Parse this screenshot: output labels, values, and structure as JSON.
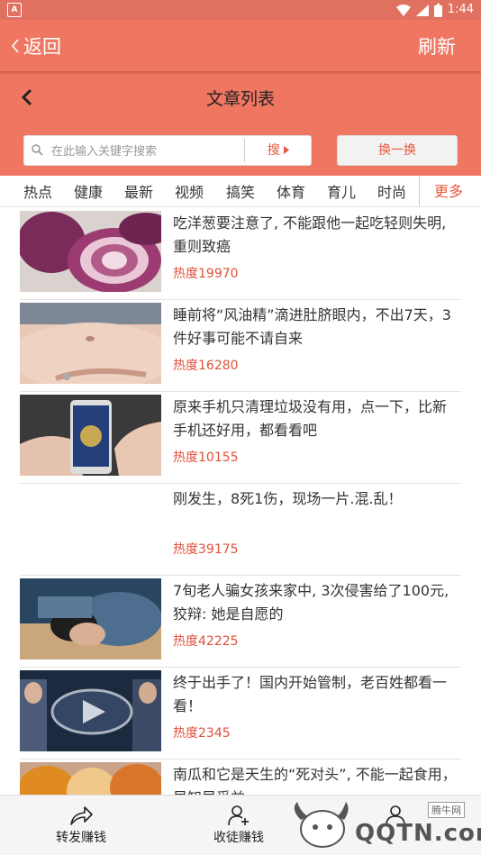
{
  "status_bar": {
    "left_badge": "A",
    "time": "1:44"
  },
  "nav": {
    "back_label": "返回",
    "refresh_label": "刷新"
  },
  "header": {
    "title": "文章列表"
  },
  "search": {
    "placeholder": "在此输入关键字搜索",
    "value": "",
    "search_button": "搜",
    "swap_button": "换一换"
  },
  "tabs": {
    "items": [
      "热点",
      "健康",
      "最新",
      "视频",
      "搞笑",
      "体育",
      "育儿",
      "时尚"
    ],
    "more": "更多"
  },
  "articles": [
    {
      "title": "吃洋葱要注意了, 不能跟他一起吃轻则失明, 重则致癌",
      "hot": "热度19970",
      "thumb": "onion-image"
    },
    {
      "title": "睡前将“风油精”滴进肚脐眼内，不出7天，3件好事可能不请自来",
      "hot": "热度16280",
      "thumb": "belly-image"
    },
    {
      "title": "原来手机只清理垃圾没有用，点一下，比新手机还好用，都看看吧",
      "hot": "热度10155",
      "thumb": "phone-image"
    },
    {
      "title": "刚发生，8死1伤，现场一片.混.乱！",
      "hot": "热度39175",
      "thumb": ""
    },
    {
      "title": "7旬老人骗女孩来家中, 3次侵害给了100元, 狡辩: 她是自愿的",
      "hot": "热度42225",
      "thumb": "sleeping-girl-image"
    },
    {
      "title": "终于出手了！国内开始管制，老百姓都看一看！",
      "hot": "热度2345",
      "thumb": "video-image"
    },
    {
      "title": "南瓜和它是天生的“死对头”, 不能一起食用，早知早受益",
      "hot": "",
      "thumb": "pumpkin-image"
    }
  ],
  "bottom_bar": {
    "items": [
      "转发赚钱",
      "收徒赚钱"
    ]
  },
  "watermark": {
    "text": "QQTN.com",
    "small": "腾牛网"
  },
  "colors": {
    "primary": "#ef7762",
    "accent": "#e8573e",
    "hot": "#e0503a"
  }
}
